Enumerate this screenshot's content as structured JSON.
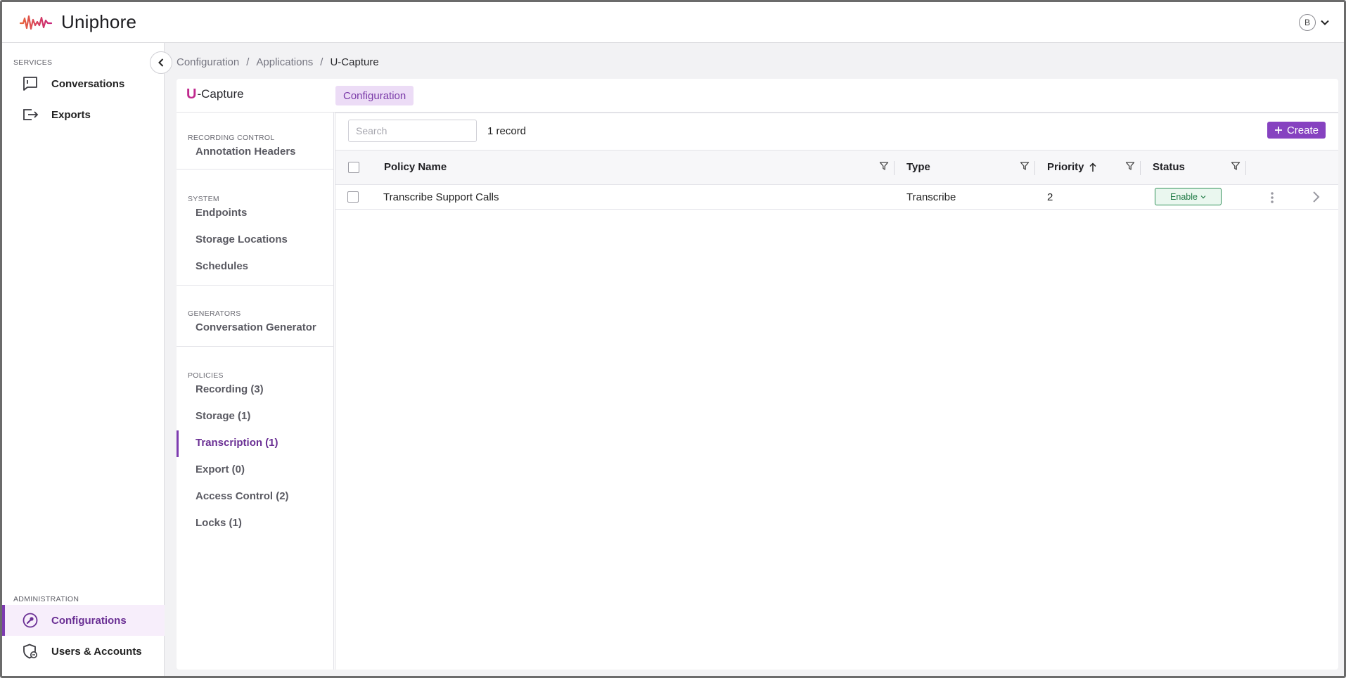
{
  "header": {
    "brand": "Uniphore",
    "avatar_initial": "B"
  },
  "sidebar": {
    "services_label": "SERVICES",
    "admin_label": "ADMINISTRATION",
    "items": [
      {
        "label": "Conversations",
        "icon": "chat-icon"
      },
      {
        "label": "Exports",
        "icon": "export-icon"
      },
      {
        "label": "Configurations",
        "icon": "wrench-icon",
        "active": true
      },
      {
        "label": "Users & Accounts",
        "icon": "shield-user-icon"
      }
    ]
  },
  "breadcrumb": {
    "items": [
      "Configuration",
      "Applications",
      "U-Capture"
    ],
    "separator": "/"
  },
  "app": {
    "title_letter": "U",
    "title_rest": "-Capture",
    "tab_label": "Configuration"
  },
  "subnav": {
    "sections": [
      {
        "label": "RECORDING CONTROL",
        "items": [
          "Annotation Headers"
        ]
      },
      {
        "label": "SYSTEM",
        "items": [
          "Endpoints",
          "Storage Locations",
          "Schedules"
        ]
      },
      {
        "label": "GENERATORS",
        "items": [
          "Conversation Generator"
        ]
      },
      {
        "label": "POLICIES",
        "items": [
          "Recording (3)",
          "Storage (1)",
          "Transcription (1)",
          "Export (0)",
          "Access Control (2)",
          "Locks (1)"
        ]
      }
    ],
    "active_item": "Transcription (1)"
  },
  "table": {
    "search_placeholder": "Search",
    "record_count": "1 record",
    "create_label": "Create",
    "columns": [
      "Policy Name",
      "Type",
      "Priority",
      "Status"
    ],
    "rows": [
      {
        "policy_name": "Transcribe Support Calls",
        "type": "Transcribe",
        "priority": "2",
        "status": "Enable"
      }
    ]
  },
  "colors": {
    "accent": "#8642c0",
    "active_text": "#6a2f94",
    "status_green": "#2e8f57"
  }
}
